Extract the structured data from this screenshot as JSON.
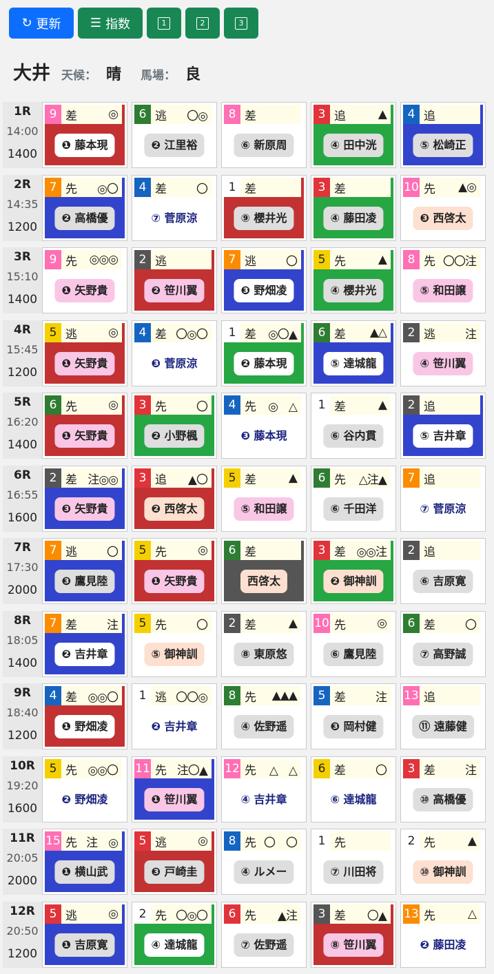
{
  "toolbar": {
    "refresh": "更新",
    "index": "指数",
    "v1": "1",
    "v2": "2",
    "v3": "3"
  },
  "venue": {
    "name": "大井",
    "weather_label": "天候：",
    "weather": "晴",
    "track_label": "馬場：",
    "track": "良"
  },
  "colors": {
    "red": "#c23232",
    "blue": "#3344cc",
    "green": "#27a644",
    "gray": "#555555",
    "white": "#ffffff"
  },
  "frame_colors": {
    "1": "#ffffff",
    "2": "#555555",
    "3": "#e0343a",
    "4": "#1565c0",
    "5": "#f5d000",
    "6": "#2e7d32",
    "7": "#fb8c00",
    "8": "#ff6fb4"
  },
  "chip_colors": {
    "white": "#ffffff",
    "gray": "#dedede",
    "pink": "#f9c6e6",
    "peach": "#fde0cf",
    "none": "transparent"
  },
  "races": [
    {
      "num": "1R",
      "time": "14:00",
      "dist": "1400",
      "horses": [
        {
          "no": "9",
          "frame": "8",
          "style": "差",
          "marks": "◎",
          "jockey": "❶ 藤本現",
          "bg": "red",
          "chip": "white"
        },
        {
          "no": "6",
          "frame": "6",
          "style": "逃",
          "marks": "〇◎",
          "jockey": "❷ 江里裕",
          "bg": "white",
          "chip": "gray"
        },
        {
          "no": "8",
          "frame": "8",
          "style": "差",
          "marks": "",
          "jockey": "⑥ 新原周",
          "bg": "white",
          "chip": "gray"
        },
        {
          "no": "3",
          "frame": "3",
          "style": "追",
          "marks": "▲",
          "jockey": "④ 田中洸",
          "bg": "green",
          "chip": "gray"
        },
        {
          "no": "4",
          "frame": "4",
          "style": "追",
          "marks": "",
          "jockey": "⑤ 松崎正",
          "bg": "blue",
          "chip": "gray"
        }
      ]
    },
    {
      "num": "2R",
      "time": "14:35",
      "dist": "1200",
      "horses": [
        {
          "no": "7",
          "frame": "7",
          "style": "先",
          "marks": "◎〇",
          "jockey": "❷ 高橋優",
          "bg": "blue",
          "chip": "gray"
        },
        {
          "no": "4",
          "frame": "4",
          "style": "差",
          "marks": "〇",
          "jockey": "⑦ 菅原涼",
          "bg": "white",
          "chip": "none"
        },
        {
          "no": "1",
          "frame": "1",
          "style": "差",
          "marks": "",
          "jockey": "⑨ 櫻井光",
          "bg": "red",
          "chip": "gray"
        },
        {
          "no": "3",
          "frame": "3",
          "style": "差",
          "marks": "",
          "jockey": "④ 藤田凌",
          "bg": "green",
          "chip": "gray"
        },
        {
          "no": "10",
          "frame": "8",
          "style": "先",
          "marks": "▲◎",
          "jockey": "❸ 西啓太",
          "bg": "white",
          "chip": "peach"
        }
      ]
    },
    {
      "num": "3R",
      "time": "15:10",
      "dist": "1400",
      "horses": [
        {
          "no": "9",
          "frame": "8",
          "style": "先",
          "marks": "◎◎◎",
          "jockey": "❶ 矢野貴",
          "bg": "white",
          "chip": "pink"
        },
        {
          "no": "2",
          "frame": "2",
          "style": "逃",
          "marks": "",
          "jockey": "❷ 笹川翼",
          "bg": "red",
          "chip": "pink"
        },
        {
          "no": "7",
          "frame": "7",
          "style": "逃",
          "marks": "〇",
          "jockey": "❸ 野畑凌",
          "bg": "blue",
          "chip": "white"
        },
        {
          "no": "5",
          "frame": "5",
          "style": "先",
          "marks": "▲",
          "jockey": "④ 櫻井光",
          "bg": "green",
          "chip": "gray"
        },
        {
          "no": "8",
          "frame": "8",
          "style": "先",
          "marks": "〇〇注",
          "jockey": "⑤ 和田譲",
          "bg": "white",
          "chip": "pink"
        }
      ]
    },
    {
      "num": "4R",
      "time": "15:45",
      "dist": "1200",
      "horses": [
        {
          "no": "5",
          "frame": "5",
          "style": "逃",
          "marks": "◎",
          "jockey": "❶ 矢野貴",
          "bg": "red",
          "chip": "pink"
        },
        {
          "no": "4",
          "frame": "4",
          "style": "差",
          "marks": "〇◎〇",
          "jockey": "❸ 菅原涼",
          "bg": "white",
          "chip": "none"
        },
        {
          "no": "1",
          "frame": "1",
          "style": "差",
          "marks": "◎〇▲",
          "jockey": "❷ 藤本現",
          "bg": "green",
          "chip": "white"
        },
        {
          "no": "6",
          "frame": "6",
          "style": "差",
          "marks": "▲△",
          "jockey": "⑤ 達城龍",
          "bg": "blue",
          "chip": "white"
        },
        {
          "no": "2",
          "frame": "2",
          "style": "逃",
          "marks": "注",
          "jockey": "④ 笹川翼",
          "bg": "white",
          "chip": "pink"
        }
      ]
    },
    {
      "num": "5R",
      "time": "16:20",
      "dist": "1400",
      "horses": [
        {
          "no": "6",
          "frame": "6",
          "style": "先",
          "marks": "◎",
          "jockey": "❶ 矢野貴",
          "bg": "red",
          "chip": "pink"
        },
        {
          "no": "3",
          "frame": "3",
          "style": "先",
          "marks": "〇",
          "jockey": "❷ 小野楓",
          "bg": "green",
          "chip": "gray"
        },
        {
          "no": "4",
          "frame": "4",
          "style": "先",
          "marks": "◎　△",
          "jockey": "❸ 藤本現",
          "bg": "white",
          "chip": "none"
        },
        {
          "no": "1",
          "frame": "1",
          "style": "差",
          "marks": "▲",
          "jockey": "⑥ 谷内貫",
          "bg": "white",
          "chip": "gray"
        },
        {
          "no": "2",
          "frame": "2",
          "style": "追",
          "marks": "",
          "jockey": "⑤ 吉井章",
          "bg": "blue",
          "chip": "white"
        }
      ]
    },
    {
      "num": "6R",
      "time": "16:55",
      "dist": "1600",
      "horses": [
        {
          "no": "2",
          "frame": "2",
          "style": "差",
          "marks": "注◎◎",
          "jockey": "❸ 矢野貴",
          "bg": "blue",
          "chip": "pink"
        },
        {
          "no": "3",
          "frame": "3",
          "style": "追",
          "marks": "▲〇",
          "jockey": "❷ 西啓太",
          "bg": "red",
          "chip": "peach"
        },
        {
          "no": "5",
          "frame": "5",
          "style": "差",
          "marks": "▲",
          "jockey": "⑤ 和田譲",
          "bg": "white",
          "chip": "pink"
        },
        {
          "no": "6",
          "frame": "6",
          "style": "先",
          "marks": "△注▲",
          "jockey": "⑥ 千田洋",
          "bg": "white",
          "chip": "gray"
        },
        {
          "no": "7",
          "frame": "7",
          "style": "追",
          "marks": "",
          "jockey": "⑦ 菅原涼",
          "bg": "white",
          "chip": "none"
        }
      ]
    },
    {
      "num": "7R",
      "time": "17:30",
      "dist": "2000",
      "horses": [
        {
          "no": "7",
          "frame": "7",
          "style": "逃",
          "marks": "〇",
          "jockey": "❸ 鷹見陸",
          "bg": "blue",
          "chip": "gray"
        },
        {
          "no": "5",
          "frame": "5",
          "style": "先",
          "marks": "◎",
          "jockey": "❶ 矢野貴",
          "bg": "red",
          "chip": "pink"
        },
        {
          "no": "6",
          "frame": "6",
          "style": "差",
          "marks": "",
          "jockey": "西啓太",
          "bg": "gray",
          "chip": "peach"
        },
        {
          "no": "3",
          "frame": "3",
          "style": "差",
          "marks": "◎◎注",
          "jockey": "❷ 御神訓",
          "bg": "green",
          "chip": "peach"
        },
        {
          "no": "2",
          "frame": "2",
          "style": "追",
          "marks": "",
          "jockey": "⑥ 吉原寛",
          "bg": "white",
          "chip": "gray"
        }
      ]
    },
    {
      "num": "8R",
      "time": "18:05",
      "dist": "1400",
      "horses": [
        {
          "no": "7",
          "frame": "7",
          "style": "差",
          "marks": "注",
          "jockey": "❷ 吉井章",
          "bg": "blue",
          "chip": "white"
        },
        {
          "no": "5",
          "frame": "5",
          "style": "先",
          "marks": "〇",
          "jockey": "⑤ 御神訓",
          "bg": "white",
          "chip": "peach"
        },
        {
          "no": "2",
          "frame": "2",
          "style": "差",
          "marks": "▲",
          "jockey": "⑧ 東原悠",
          "bg": "white",
          "chip": "gray"
        },
        {
          "no": "10",
          "frame": "8",
          "style": "先",
          "marks": "◎",
          "jockey": "⑥ 鷹見陸",
          "bg": "white",
          "chip": "gray"
        },
        {
          "no": "6",
          "frame": "6",
          "style": "差",
          "marks": "〇",
          "jockey": "⑦ 高野誠",
          "bg": "white",
          "chip": "gray"
        }
      ]
    },
    {
      "num": "9R",
      "time": "18:40",
      "dist": "1200",
      "horses": [
        {
          "no": "4",
          "frame": "4",
          "style": "差",
          "marks": "◎◎〇",
          "jockey": "❶ 野畑凌",
          "bg": "red",
          "chip": "white"
        },
        {
          "no": "1",
          "frame": "1",
          "style": "逃",
          "marks": "〇〇◎",
          "jockey": "❷ 吉井章",
          "bg": "white",
          "chip": "none"
        },
        {
          "no": "8",
          "frame": "6",
          "style": "先",
          "marks": "▲▲▲",
          "jockey": "④ 佐野遥",
          "bg": "white",
          "chip": "gray"
        },
        {
          "no": "5",
          "frame": "4",
          "style": "差",
          "marks": "注",
          "jockey": "❸ 岡村健",
          "bg": "white",
          "chip": "gray"
        },
        {
          "no": "13",
          "frame": "8",
          "style": "追",
          "marks": "",
          "jockey": "⑪ 遠藤健",
          "bg": "white",
          "chip": "gray"
        }
      ]
    },
    {
      "num": "10R",
      "time": "19:20",
      "dist": "1600",
      "horses": [
        {
          "no": "5",
          "frame": "5",
          "style": "先",
          "marks": "◎◎〇",
          "jockey": "❷ 野畑凌",
          "bg": "white",
          "chip": "none"
        },
        {
          "no": "11",
          "frame": "8",
          "style": "先",
          "marks": "注〇▲",
          "jockey": "❶ 笹川翼",
          "bg": "blue",
          "chip": "pink"
        },
        {
          "no": "12",
          "frame": "8",
          "style": "先",
          "marks": "△　△",
          "jockey": "④ 吉井章",
          "bg": "white",
          "chip": "none"
        },
        {
          "no": "6",
          "frame": "5",
          "style": "差",
          "marks": "〇",
          "jockey": "⑥ 達城龍",
          "bg": "white",
          "chip": "none"
        },
        {
          "no": "3",
          "frame": "3",
          "style": "差",
          "marks": "注",
          "jockey": "⑩ 高橋優",
          "bg": "white",
          "chip": "gray"
        }
      ]
    },
    {
      "num": "11R",
      "time": "20:05",
      "dist": "2000",
      "horses": [
        {
          "no": "15",
          "frame": "8",
          "style": "先",
          "marks": "注　◎",
          "jockey": "❶ 横山武",
          "bg": "blue",
          "chip": "gray"
        },
        {
          "no": "5",
          "frame": "3",
          "style": "逃",
          "marks": "◎",
          "jockey": "❸ 戸崎圭",
          "bg": "red",
          "chip": "gray"
        },
        {
          "no": "8",
          "frame": "4",
          "style": "先",
          "marks": "〇　〇",
          "jockey": "④ ルメー",
          "bg": "white",
          "chip": "gray"
        },
        {
          "no": "1",
          "frame": "1",
          "style": "先",
          "marks": "",
          "jockey": "⑦ 川田将",
          "bg": "white",
          "chip": "gray"
        },
        {
          "no": "2",
          "frame": "1",
          "style": "先",
          "marks": "▲",
          "jockey": "⑩ 御神訓",
          "bg": "white",
          "chip": "peach"
        }
      ]
    },
    {
      "num": "12R",
      "time": "20:50",
      "dist": "1200",
      "horses": [
        {
          "no": "5",
          "frame": "3",
          "style": "逃",
          "marks": "◎",
          "jockey": "❶ 吉原寛",
          "bg": "blue",
          "chip": "gray"
        },
        {
          "no": "2",
          "frame": "1",
          "style": "先",
          "marks": "〇◎〇",
          "jockey": "④ 達城龍",
          "bg": "green",
          "chip": "white"
        },
        {
          "no": "6",
          "frame": "3",
          "style": "先",
          "marks": "▲注",
          "jockey": "⑦ 佐野遥",
          "bg": "white",
          "chip": "gray"
        },
        {
          "no": "3",
          "frame": "2",
          "style": "差",
          "marks": "〇▲",
          "jockey": "⑧ 笹川翼",
          "bg": "red",
          "chip": "pink"
        },
        {
          "no": "13",
          "frame": "7",
          "style": "先",
          "marks": "△",
          "jockey": "❷ 藤田凌",
          "bg": "white",
          "chip": "none"
        }
      ]
    }
  ]
}
